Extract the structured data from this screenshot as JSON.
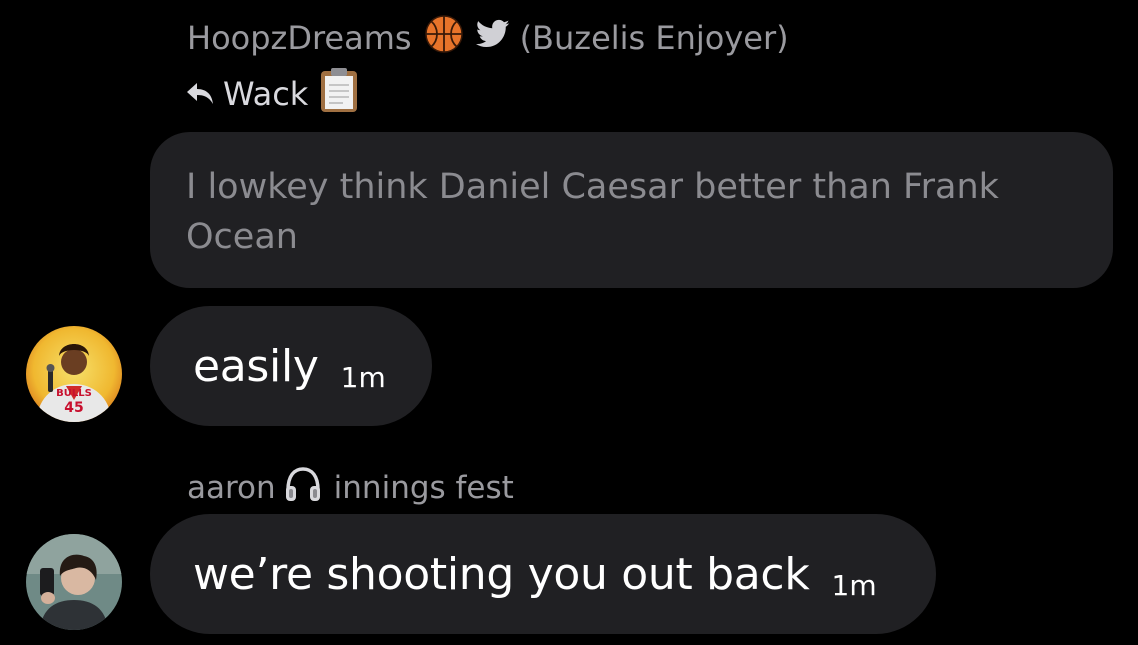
{
  "quoted_message": {
    "sender_name": "HoopzDreams",
    "sender_suffix": "(Buzelis Enjoyer)",
    "reply_label": "Wack",
    "text": "I lowkey think Daniel Caesar better than Frank Ocean"
  },
  "messages": [
    {
      "text": "easily",
      "time": "1m"
    },
    {
      "sender_name": "aaron",
      "sender_suffix": "innings fest",
      "text": "we’re shooting you out back",
      "time": "1m"
    }
  ],
  "icons": {
    "basketball": "basketball-icon",
    "bird": "twitter-bird-icon",
    "reply": "reply-arrow-icon",
    "clipboard": "clipboard-icon",
    "headphones": "headphones-icon"
  },
  "colors": {
    "background": "#000000",
    "bubble": "#202023",
    "secondary_text": "#9a9a9f",
    "quoted_text": "#8b8b90"
  }
}
